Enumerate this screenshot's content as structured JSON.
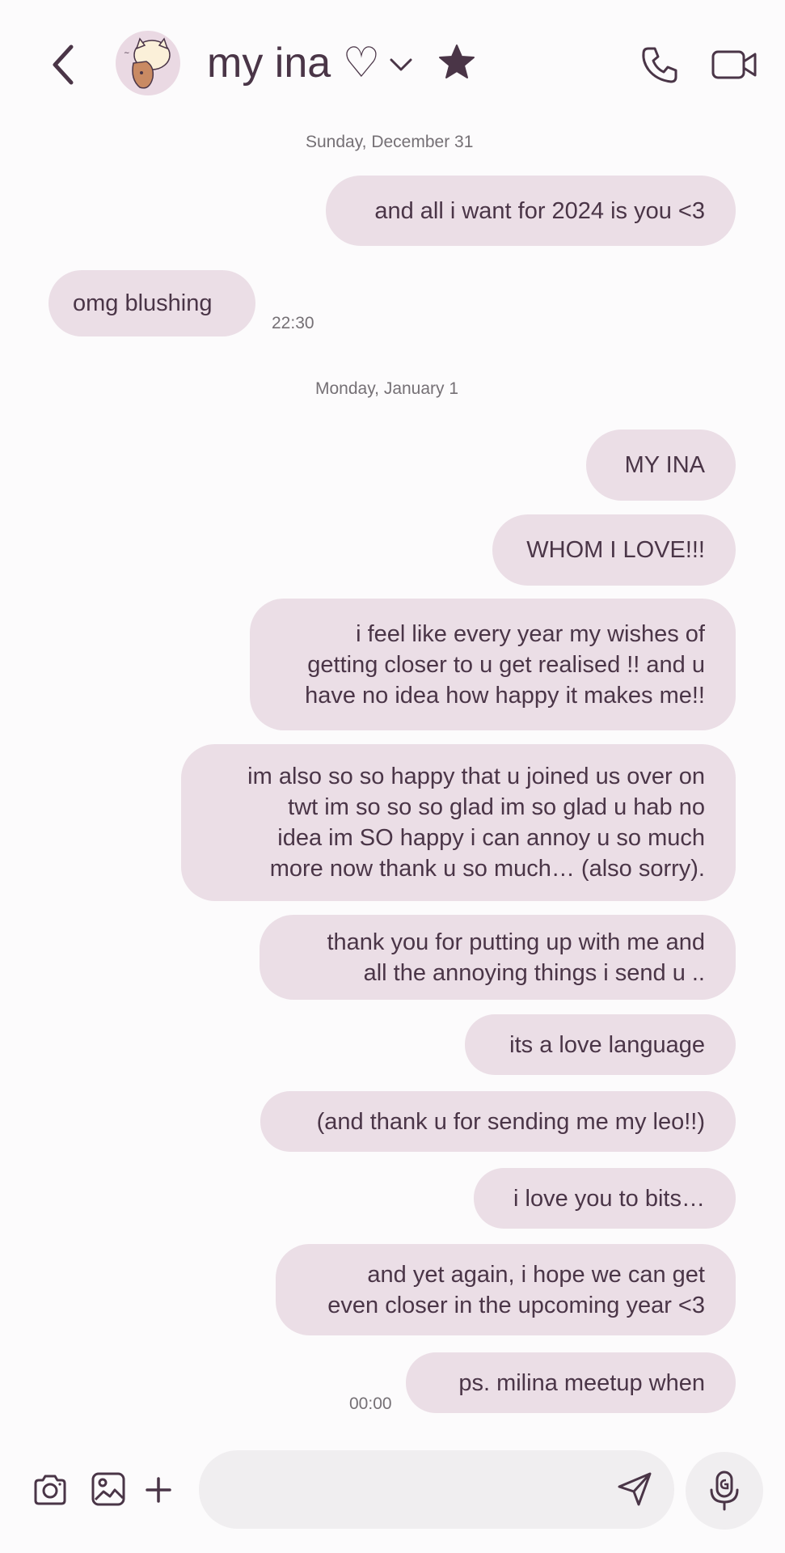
{
  "header": {
    "contact_name": "my ina ♡",
    "icons": [
      "back-arrow-icon",
      "contact-avatar",
      "chevron-down-icon",
      "star-icon",
      "phone-icon",
      "video-icon"
    ]
  },
  "messages": {
    "date1": "Sunday, December 31",
    "m1": "and all i want for 2024 is you <3",
    "m2": "omg blushing",
    "m2_time": "22:30",
    "date2": "Monday, January 1",
    "m3": "MY INA",
    "m4": "WHOM I LOVE!!!",
    "m5": [
      "i feel like every year my wishes of",
      "getting closer to u get realised !! and u",
      "have no idea how happy it makes me!!"
    ],
    "m6": [
      "im also so so happy that u joined us over on",
      "twt im so so so glad im so glad u hab no",
      "idea im SO happy i can annoy u so much",
      "more now thank u so much… (also sorry)."
    ],
    "m7": [
      "thank you for putting up with me and",
      "all the annoying things i send u .."
    ],
    "m8": "its a love language",
    "m9": "(and thank u for sending me my leo!!)",
    "m10": "i love you to bits…",
    "m11": [
      "and yet again, i hope we can get",
      "even closer in the upcoming year <3"
    ],
    "m12": "ps. milina meetup when",
    "m12_time": "00:00"
  },
  "composer": {
    "placeholder": "",
    "icons": [
      "camera-icon",
      "gallery-icon",
      "plus-icon",
      "send-icon",
      "microphone-icon"
    ]
  },
  "colors": {
    "background": "#fcfbfc",
    "bubble": "#ebdee6",
    "text": "#4a3547",
    "meta_text": "#757075",
    "input": "#f0eef0"
  }
}
